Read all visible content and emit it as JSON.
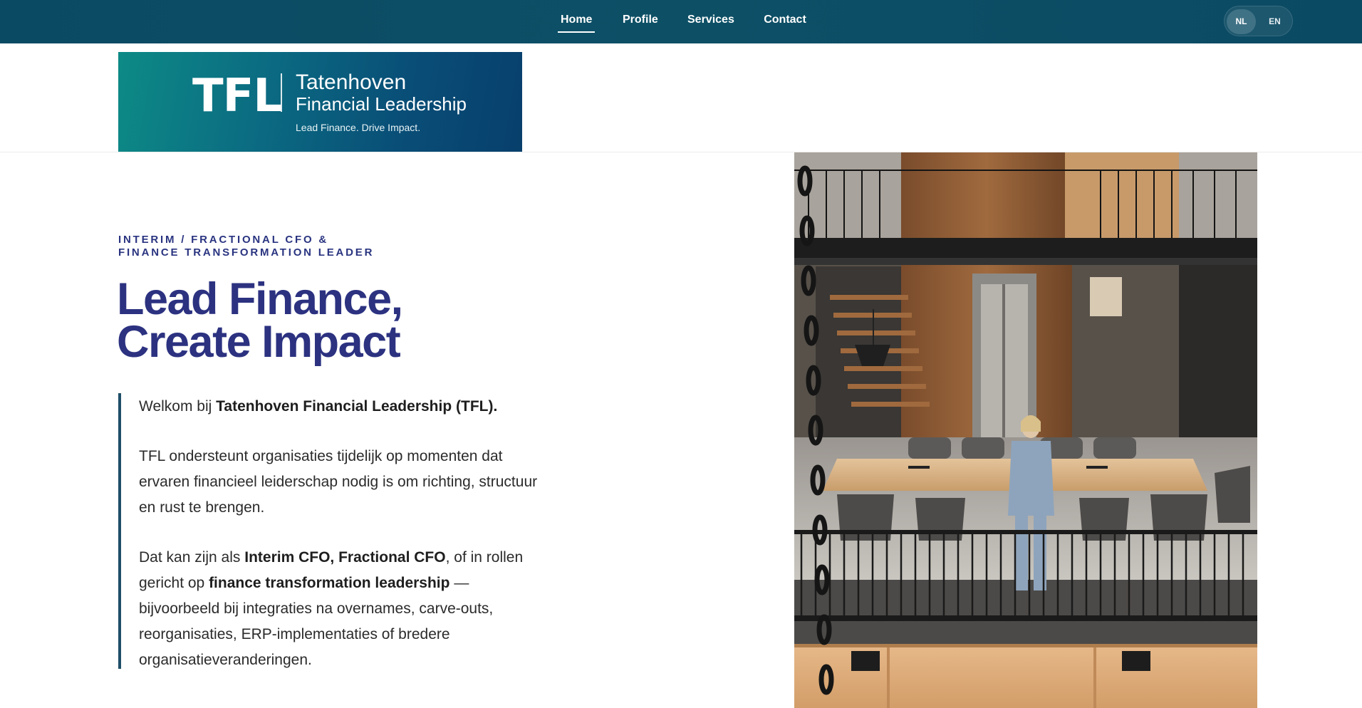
{
  "nav": {
    "items": [
      {
        "label": "Home",
        "active": true
      },
      {
        "label": "Profile",
        "active": false
      },
      {
        "label": "Services",
        "active": false
      },
      {
        "label": "Contact",
        "active": false
      }
    ],
    "languages": [
      {
        "label": "NL",
        "active": true
      },
      {
        "label": "EN",
        "active": false
      }
    ]
  },
  "logo": {
    "mark": "TFL",
    "title": "Tatenhoven",
    "subtitle": "Financial Leadership",
    "tagline": "Lead Finance. Drive Impact."
  },
  "hero": {
    "eyebrow_line1": "INTERIM / FRACTIONAL CFO &",
    "eyebrow_line2": "FINANCE TRANSFORMATION LEADER",
    "title_line1": "Lead Finance,",
    "title_line2": "Create Impact"
  },
  "intro": {
    "p1_prefix": "Welkom bij ",
    "p1_bold": "Tatenhoven Financial Leadership (TFL).",
    "p2": "TFL ondersteunt organisaties tijdelijk op momenten dat ervaren financieel leiderschap nodig is om richting, structuur en rust te brengen.",
    "p3_prefix": "Dat kan zijn als ",
    "p3_bold1": "Interim CFO, Fractional CFO",
    "p3_mid": ", of in rollen gericht op ",
    "p3_bold2": "finance transformation leadership",
    "p3_suffix": " — bijvoorbeeld bij integraties na overnames, carve-outs, reorganisaties, ERP-implementaties of bredere organisatieveranderingen."
  },
  "colors": {
    "nav_bg": "#0b4a63",
    "heading": "#2c3280",
    "accent_bar": "#1f4e68"
  }
}
